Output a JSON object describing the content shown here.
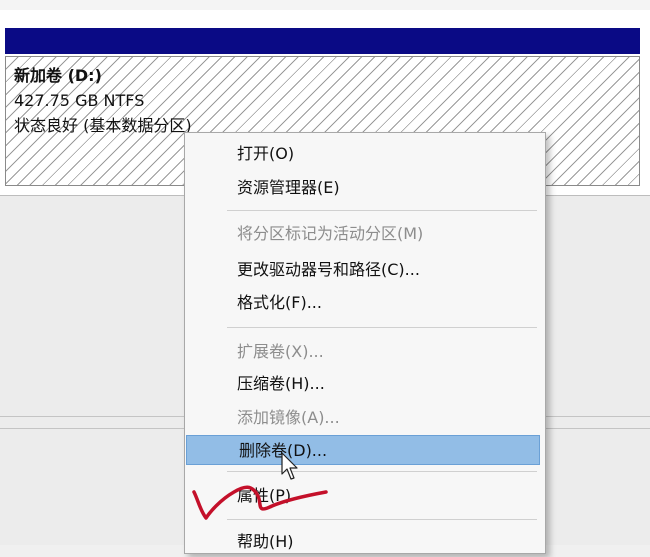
{
  "volume": {
    "name": "新加卷  (D:)",
    "size": "427.75 GB NTFS",
    "status": "状态良好 (基本数据分区)"
  },
  "context_menu": {
    "items": [
      {
        "label": "打开(O)",
        "enabled": true
      },
      {
        "label": "资源管理器(E)",
        "enabled": true
      },
      {
        "label": "将分区标记为活动分区(M)",
        "enabled": false
      },
      {
        "label": "更改驱动器号和路径(C)...",
        "enabled": true
      },
      {
        "label": "格式化(F)...",
        "enabled": true
      },
      {
        "label": "扩展卷(X)...",
        "enabled": false
      },
      {
        "label": "压缩卷(H)...",
        "enabled": true
      },
      {
        "label": "添加镜像(A)...",
        "enabled": false
      },
      {
        "label": "删除卷(D)...",
        "enabled": true,
        "selected": true
      },
      {
        "label": "属性(P)",
        "enabled": true
      },
      {
        "label": "帮助(H)",
        "enabled": true
      }
    ]
  },
  "colors": {
    "header_bar": "#0a0a85",
    "selection": "#92bde6",
    "annotation": "#c4102a"
  }
}
